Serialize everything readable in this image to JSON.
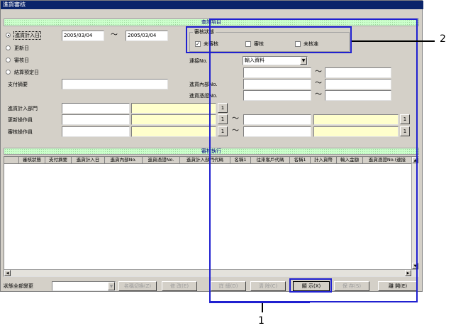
{
  "title": "進貨審核",
  "search_band": "查詢項目",
  "results_band": "審核執行",
  "date_radios": [
    {
      "label": "進貨計入日",
      "selected": true
    },
    {
      "label": "更新日",
      "selected": false
    },
    {
      "label": "審核日",
      "selected": false
    },
    {
      "label": "結算預定日",
      "selected": false
    }
  ],
  "date_from": "2005/03/04",
  "date_to": "2005/03/04",
  "tilde": "～",
  "status_group": {
    "title": "審核狀態",
    "options": [
      {
        "label": "未審核",
        "checked": true
      },
      {
        "label": "審核",
        "checked": false
      },
      {
        "label": "未核准",
        "checked": false
      }
    ]
  },
  "check_mark": "✓",
  "fields": {
    "payment_summary": "支付摘要",
    "link_no": "連接No.",
    "link_select_value": "輸入資料",
    "internal_no": "進貨內部No.",
    "voucher_no": "進貨憑證No.",
    "dept": "進貨計入部門",
    "updater": "更新操作員",
    "reviewer": "審核操作員",
    "lookup_button": "1"
  },
  "columns": [
    "審核狀態",
    "支付摘要",
    "進貨計入日",
    "進貨內部No.",
    "進貨憑證No.",
    "進貨計入部門代碼",
    "名稱1",
    "往來客戶代碼",
    "名稱1",
    "計入貨幣",
    "輸入金額",
    "進貨憑證No.(連接"
  ],
  "bottom": {
    "change_all_label": "狀態全部變更",
    "buttons": [
      {
        "label": "名稱切換(Z)",
        "enabled": false
      },
      {
        "label": "修 改(E)",
        "enabled": false
      },
      {
        "label": "詳 細(D)",
        "enabled": false
      },
      {
        "label": "清 除(C)",
        "enabled": false
      },
      {
        "label": "顯 示(X)",
        "enabled": true
      },
      {
        "label": "保 存(S)",
        "enabled": false
      },
      {
        "label": "離 開(E)",
        "enabled": true
      }
    ]
  },
  "callouts": [
    "1",
    "2"
  ],
  "colors": {
    "highlight": "#2020d0",
    "titlebar": "#0a246a"
  }
}
